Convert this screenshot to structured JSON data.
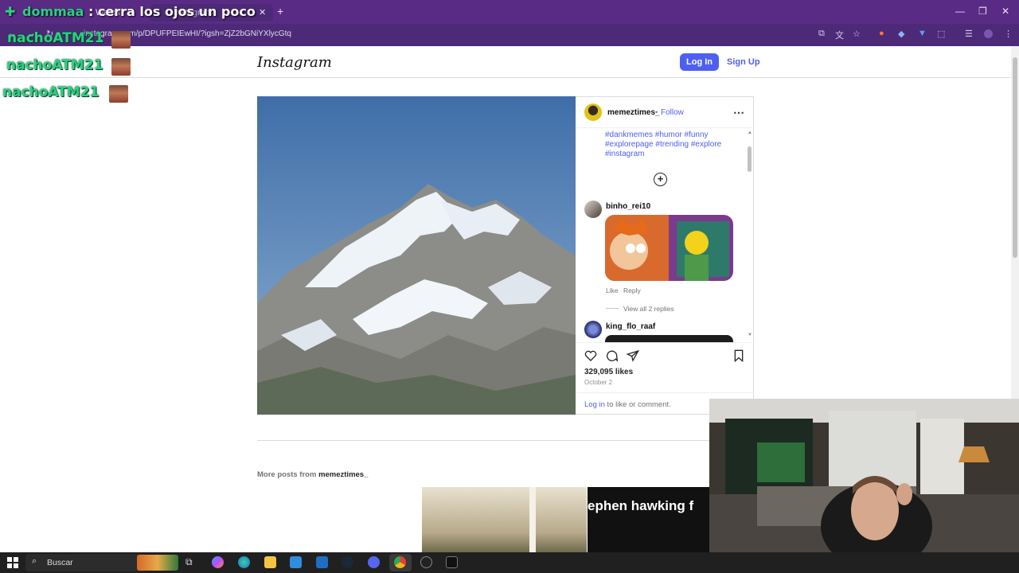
{
  "browser": {
    "tabs": [
      {
        "label": "Watch"
      },
      {
        "label": "Instagram"
      }
    ],
    "new_tab": "+",
    "url": "instagram.com/p/DPUFPEIEwHI/?igsh=ZjZ2bGNiYXlycGtq",
    "window_controls": [
      "—",
      "❐",
      "✕"
    ]
  },
  "stream_overlay": {
    "title_user": "dommaa",
    "title_text": " : cerra los ojos un poco",
    "chat": [
      {
        "user": "nachoATM21",
        "sep": ":"
      },
      {
        "user": "nachoATM21",
        "sep": ":"
      },
      {
        "user": "nachoATM21",
        "sep": ":"
      }
    ]
  },
  "instagram": {
    "logo": "Instagram",
    "login_label": "Log In",
    "signup_label": "Sign Up",
    "post": {
      "author": "memeztimes_",
      "follow_dot": "•",
      "follow_label": "Follow",
      "more_icon": "⋯",
      "hashtags": "#dankmemes #humor #funny #explorepage #trending #explore #instagram",
      "comments": [
        {
          "user": "binho_rei10",
          "actions": [
            "Like",
            "Reply"
          ],
          "replies": "View all 2 replies"
        },
        {
          "user": "king_flo_raaf"
        }
      ],
      "likes": "329,095 likes",
      "date": "October 2",
      "login_link": "Log in",
      "login_rest": " to like or comment."
    },
    "more_posts_prefix": "More posts from ",
    "more_posts_user": "memeztimes_",
    "thumb_text": "ephen hawking f"
  },
  "taskbar": {
    "search_placeholder": "Buscar"
  },
  "colors": {
    "browser_purple": "#5a2b85",
    "instagram_blue": "#4d5ff2",
    "chat_green": "#2ad182"
  }
}
